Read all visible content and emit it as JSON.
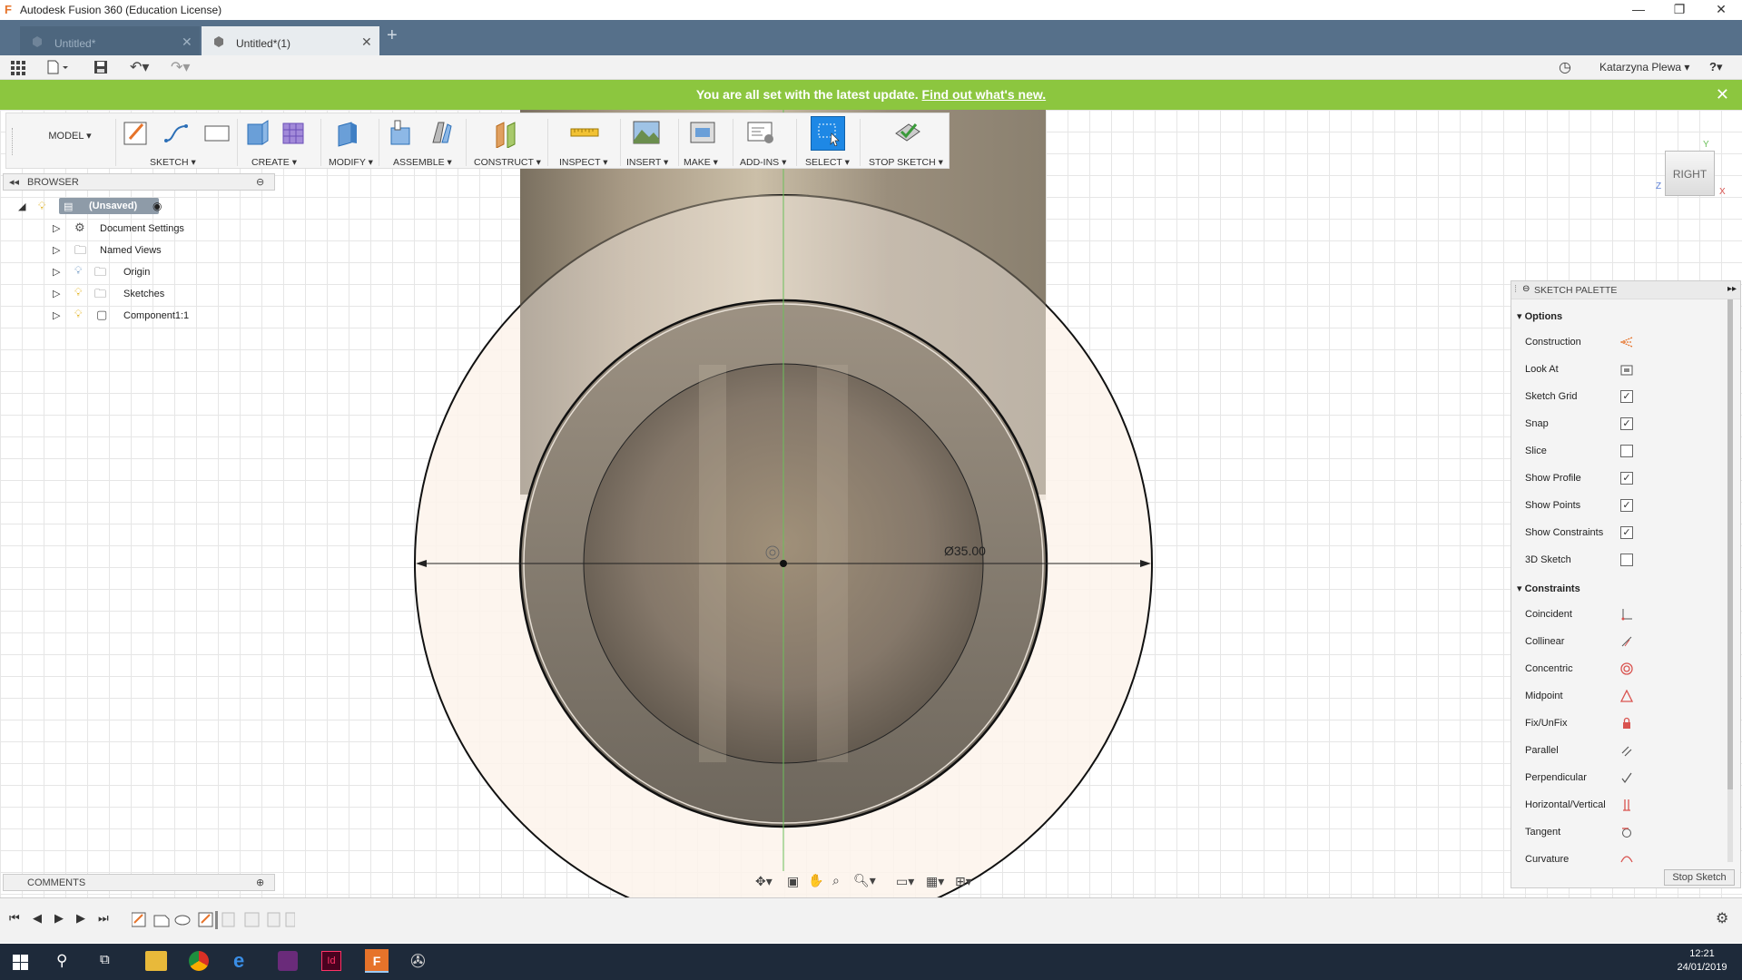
{
  "window": {
    "title": "Autodesk Fusion 360 (Education License)"
  },
  "tabs": [
    {
      "label": "Untitled*",
      "active": false
    },
    {
      "label": "Untitled*(1)",
      "active": true
    }
  ],
  "quickbar": {
    "user": "Katarzyna Plewa ▾",
    "help": "?▾"
  },
  "banner": {
    "text": "You are all set with the latest update.",
    "link": "Find out what's new."
  },
  "toolbar": {
    "workspace": "MODEL",
    "groups": [
      "SKETCH",
      "CREATE",
      "MODIFY",
      "ASSEMBLE",
      "CONSTRUCT",
      "INSPECT",
      "INSERT",
      "MAKE",
      "ADD-INS",
      "SELECT",
      "STOP SKETCH"
    ]
  },
  "browser": {
    "title": "BROWSER",
    "root": "(Unsaved)",
    "items": [
      "Document Settings",
      "Named Views",
      "Origin",
      "Sketches",
      "Component1:1"
    ]
  },
  "comments": {
    "title": "COMMENTS"
  },
  "viewcube": {
    "face": "RIGHT",
    "axis_y": "Y",
    "axis_z": "Z",
    "axis_x": "X"
  },
  "dimension": {
    "label": "Ø35.00"
  },
  "palette": {
    "title": "SKETCH PALETTE",
    "options_header": "Options",
    "options": [
      {
        "label": "Construction",
        "type": "icon",
        "icon": "construction-icon"
      },
      {
        "label": "Look At",
        "type": "icon",
        "icon": "look-at-icon"
      },
      {
        "label": "Sketch Grid",
        "type": "check",
        "checked": true
      },
      {
        "label": "Snap",
        "type": "check",
        "checked": true
      },
      {
        "label": "Slice",
        "type": "check",
        "checked": false
      },
      {
        "label": "Show Profile",
        "type": "check",
        "checked": true
      },
      {
        "label": "Show Points",
        "type": "check",
        "checked": true
      },
      {
        "label": "Show Constraints",
        "type": "check",
        "checked": true
      },
      {
        "label": "3D Sketch",
        "type": "check",
        "checked": false
      }
    ],
    "constraints_header": "Constraints",
    "constraints": [
      {
        "label": "Coincident",
        "icon": "coincident-icon"
      },
      {
        "label": "Collinear",
        "icon": "collinear-icon"
      },
      {
        "label": "Concentric",
        "icon": "concentric-icon"
      },
      {
        "label": "Midpoint",
        "icon": "midpoint-icon"
      },
      {
        "label": "Fix/UnFix",
        "icon": "fix-icon"
      },
      {
        "label": "Parallel",
        "icon": "parallel-icon"
      },
      {
        "label": "Perpendicular",
        "icon": "perpendicular-icon"
      },
      {
        "label": "Horizontal/Vertical",
        "icon": "horizontal-vertical-icon"
      },
      {
        "label": "Tangent",
        "icon": "tangent-icon"
      },
      {
        "label": "Curvature",
        "icon": "curvature-icon"
      }
    ],
    "stop_button": "Stop Sketch"
  },
  "taskbar": {
    "time": "12:21",
    "date": "24/01/2019"
  },
  "colors": {
    "accent": "#8cc63f",
    "tabbar": "#56708a",
    "select_active": "#1e88e5",
    "taskbar": "#1e2a3a"
  }
}
